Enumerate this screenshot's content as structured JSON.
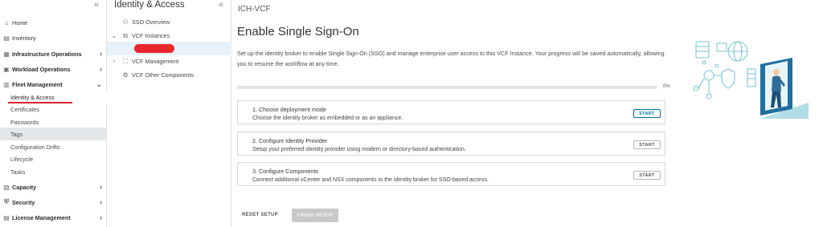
{
  "nav": {
    "items": [
      {
        "label": "Home",
        "icon": "home-icon"
      },
      {
        "label": "Inventory",
        "icon": "inventory-icon"
      },
      {
        "label": "Infrastructure Operations",
        "icon": "infrastructure-icon"
      },
      {
        "label": "Workload Operations",
        "icon": "workload-icon"
      },
      {
        "label": "Fleet Management",
        "icon": "fleet-icon"
      },
      {
        "label": "Identity & Access"
      },
      {
        "label": "Certificates"
      },
      {
        "label": "Passwords"
      },
      {
        "label": "Tags"
      },
      {
        "label": "Configuration Drifts"
      },
      {
        "label": "Lifecycle"
      },
      {
        "label": "Tasks"
      },
      {
        "label": "Capacity",
        "icon": "capacity-icon"
      },
      {
        "label": "Security",
        "icon": "security-icon"
      },
      {
        "label": "License Management",
        "icon": "license-icon"
      }
    ],
    "collapse_glyph": "«"
  },
  "panel": {
    "title": "Identity & Access",
    "collapse_glyph": "«",
    "tree": [
      {
        "label": "SSO Overview",
        "icon": "sso-icon"
      },
      {
        "label": "VCF Instances",
        "icon": "instances-icon"
      },
      {
        "label": "VCF Management",
        "icon": "management-icon"
      },
      {
        "label": "VCF Other Components",
        "icon": "components-icon"
      }
    ]
  },
  "main": {
    "breadcrumb": "ICH-VCF",
    "title": "Enable Single Sign-On",
    "description": "Set up the identity broker to enable Single Sign-On (SSO) and manage enterprise user access to this VCF Instance. Your progress will be saved automatically, allowing you to resume the workflow at any time.",
    "progress": 0,
    "progress_label": "0%",
    "steps": [
      {
        "title": "1. Choose deployment mode",
        "description": "Choose the identity broker as embedded or as an appliance.",
        "button": "START"
      },
      {
        "title": "2. Configure Identity Provider",
        "description": "Setup your preferred identity provider using modern or directory-based authentication.",
        "button": "START"
      },
      {
        "title": "3. Configure Components",
        "description": "Connect additional vCenter and NSX components to the identity broker for SSO-based access.",
        "button": "START"
      }
    ],
    "reset_label": "RESET SETUP",
    "finish_label": "FINISH SETUP"
  },
  "colors": {
    "accent": "#0072a3",
    "highlight_red": "#d9232d",
    "selected_bg": "#e5f2fb",
    "illustration_blue": "#1f6f9f",
    "illustration_teal": "#4fb3c8"
  }
}
